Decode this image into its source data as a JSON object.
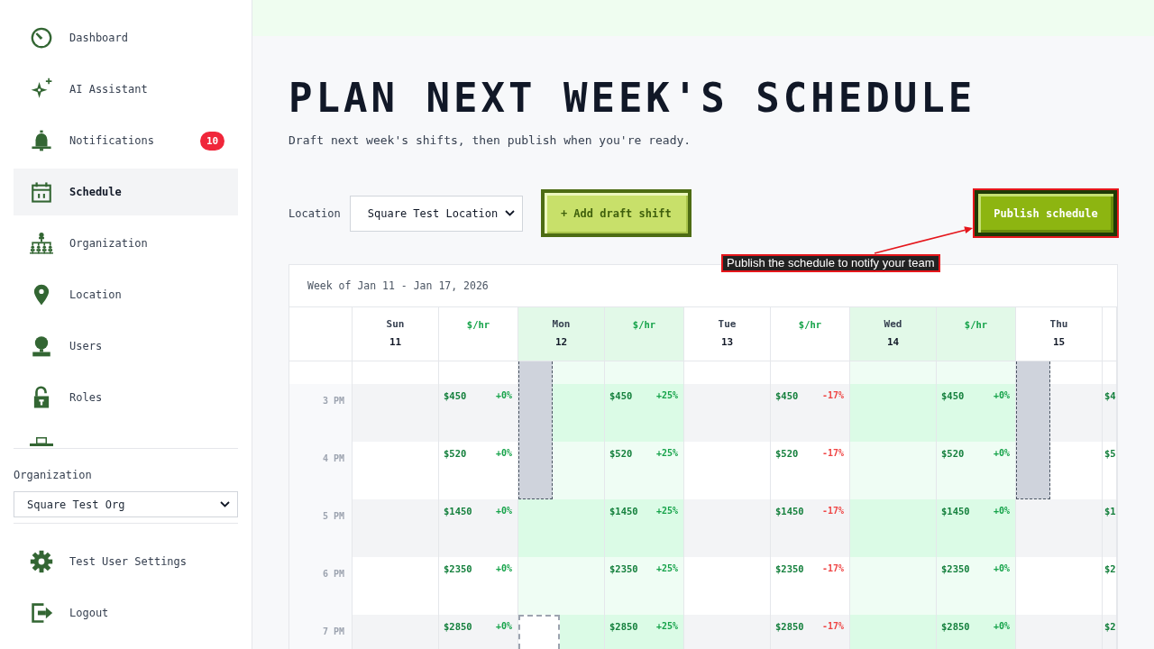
{
  "sidebar": {
    "nav": [
      {
        "label": "Dashboard",
        "selected": false
      },
      {
        "label": "AI Assistant",
        "selected": false
      },
      {
        "label": "Notifications",
        "selected": false,
        "badge": "10"
      },
      {
        "label": "Schedule",
        "selected": true
      },
      {
        "label": "Organization",
        "selected": false
      },
      {
        "label": "Location",
        "selected": false
      },
      {
        "label": "Users",
        "selected": false
      },
      {
        "label": "Roles",
        "selected": false
      },
      {
        "selected": false
      }
    ],
    "organization": {
      "label": "Organization",
      "value": "Square Test Org"
    },
    "footer": [
      {
        "label": "Test User Settings"
      },
      {
        "label": "Logout"
      }
    ]
  },
  "page": {
    "title": "PLAN NEXT WEEK'S SCHEDULE",
    "subtitle": "Draft next week's shifts, then publish when you're ready."
  },
  "toolbar": {
    "location_label": "Location",
    "location": "Square Test Location",
    "add_button": "+ Add draft shift",
    "publish_button": "Publish schedule"
  },
  "annotation": {
    "text": "Publish the schedule to notify your team"
  },
  "schedule": {
    "week": "Week of Jan 11 - Jan 17, 2026",
    "columns": [
      {
        "kind": "day",
        "day": "Sun",
        "date": "11",
        "highlighted": false
      },
      {
        "kind": "rate",
        "label": "$/hr",
        "highlighted": false
      },
      {
        "kind": "day",
        "day": "Mon",
        "date": "12",
        "highlighted": true
      },
      {
        "kind": "rate",
        "label": "$/hr",
        "highlighted": true
      },
      {
        "kind": "day",
        "day": "Tue",
        "date": "13",
        "highlighted": false
      },
      {
        "kind": "rate",
        "label": "$/hr",
        "highlighted": false
      },
      {
        "kind": "day",
        "day": "Wed",
        "date": "14",
        "highlighted": true
      },
      {
        "kind": "rate",
        "label": "$/hr",
        "highlighted": true
      },
      {
        "kind": "day",
        "day": "Thu",
        "date": "15",
        "highlighted": false
      },
      {
        "kind": "rate",
        "highlighted": false
      }
    ],
    "rows": [
      {
        "cells": [
          {
            "kind": "day"
          },
          {
            "kind": "rate"
          },
          {
            "kind": "unavailable"
          },
          {
            "kind": "rate"
          },
          {
            "kind": "day"
          },
          {
            "kind": "rate"
          },
          {
            "kind": "day"
          },
          {
            "kind": "rate"
          },
          {
            "kind": "unavailable"
          },
          {
            "kind": "rate"
          }
        ]
      },
      {
        "time": "3 PM",
        "cells": [
          {
            "kind": "day"
          },
          {
            "kind": "rate",
            "rate": "$450",
            "change": "+0%",
            "negative": false
          },
          {
            "kind": "unavailable"
          },
          {
            "kind": "rate",
            "rate": "$450",
            "change": "+25%",
            "negative": false
          },
          {
            "kind": "day"
          },
          {
            "kind": "rate",
            "rate": "$450",
            "change": "-17%",
            "negative": true
          },
          {
            "kind": "day"
          },
          {
            "kind": "rate",
            "rate": "$450",
            "change": "+0%",
            "negative": false
          },
          {
            "kind": "unavailable"
          },
          {
            "kind": "rate",
            "rate": "$4"
          }
        ]
      },
      {
        "time": "4 PM",
        "cells": [
          {
            "kind": "day"
          },
          {
            "kind": "rate",
            "rate": "$520",
            "change": "+0%",
            "negative": false
          },
          {
            "kind": "unavailable"
          },
          {
            "kind": "rate",
            "rate": "$520",
            "change": "+25%",
            "negative": false
          },
          {
            "kind": "day"
          },
          {
            "kind": "rate",
            "rate": "$520",
            "change": "-17%",
            "negative": true
          },
          {
            "kind": "day"
          },
          {
            "kind": "rate",
            "rate": "$520",
            "change": "+0%",
            "negative": false
          },
          {
            "kind": "unavailable"
          },
          {
            "kind": "rate",
            "rate": "$5"
          }
        ]
      },
      {
        "time": "5 PM",
        "cells": [
          {
            "kind": "day"
          },
          {
            "kind": "rate",
            "rate": "$1450",
            "change": "+0%",
            "negative": false
          },
          {
            "kind": "day"
          },
          {
            "kind": "rate",
            "rate": "$1450",
            "change": "+25%",
            "negative": false
          },
          {
            "kind": "day"
          },
          {
            "kind": "rate",
            "rate": "$1450",
            "change": "-17%",
            "negative": true
          },
          {
            "kind": "day"
          },
          {
            "kind": "rate",
            "rate": "$1450",
            "change": "+0%",
            "negative": false
          },
          {
            "kind": "day"
          },
          {
            "kind": "rate",
            "rate": "$1"
          }
        ]
      },
      {
        "time": "6 PM",
        "cells": [
          {
            "kind": "day"
          },
          {
            "kind": "rate",
            "rate": "$2350",
            "change": "+0%",
            "negative": false
          },
          {
            "kind": "day"
          },
          {
            "kind": "rate",
            "rate": "$2350",
            "change": "+25%",
            "negative": false
          },
          {
            "kind": "day"
          },
          {
            "kind": "rate",
            "rate": "$2350",
            "change": "-17%",
            "negative": true
          },
          {
            "kind": "day"
          },
          {
            "kind": "rate",
            "rate": "$2350",
            "change": "+0%",
            "negative": false
          },
          {
            "kind": "day"
          },
          {
            "kind": "rate",
            "rate": "$2"
          }
        ]
      },
      {
        "time": "7 PM",
        "cells": [
          {
            "kind": "day"
          },
          {
            "kind": "rate",
            "rate": "$2850",
            "change": "+0%",
            "negative": false
          },
          {
            "kind": "draft"
          },
          {
            "kind": "rate",
            "rate": "$2850",
            "change": "+25%",
            "negative": false
          },
          {
            "kind": "day"
          },
          {
            "kind": "rate",
            "rate": "$2850",
            "change": "-17%",
            "negative": true
          },
          {
            "kind": "day"
          },
          {
            "kind": "rate",
            "rate": "$2850",
            "change": "+0%",
            "negative": false
          },
          {
            "kind": "day"
          },
          {
            "kind": "rate",
            "rate": "$2"
          }
        ]
      }
    ]
  }
}
